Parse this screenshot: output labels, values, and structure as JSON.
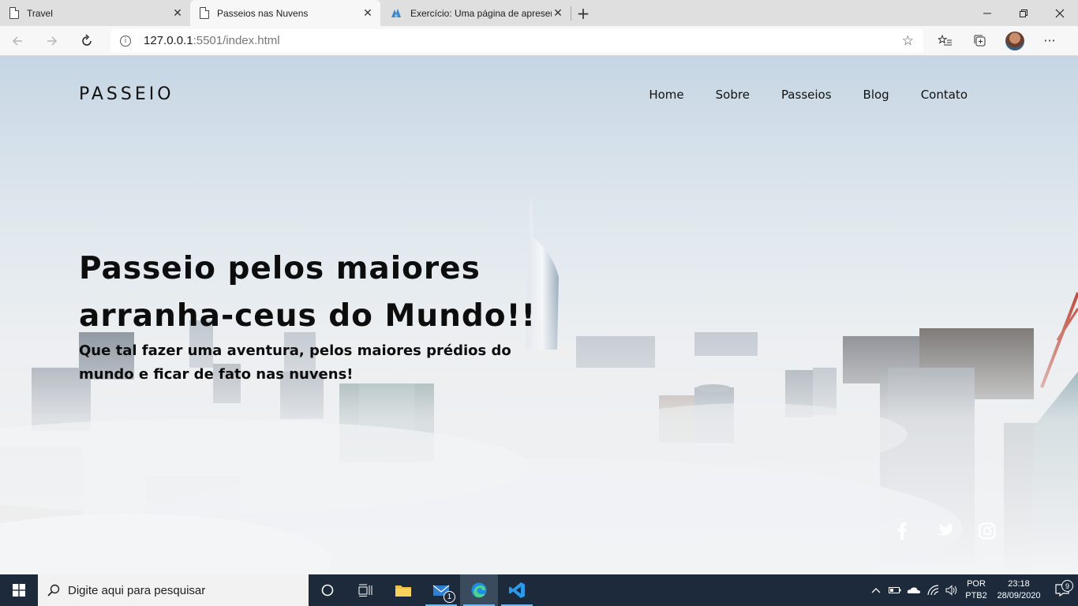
{
  "browser": {
    "tabs": [
      {
        "title": "Travel",
        "active": false,
        "icon": "page-icon"
      },
      {
        "title": "Passeios nas Nuvens",
        "active": true,
        "icon": "page-icon"
      },
      {
        "title": "Exercício: Uma página de apresen",
        "active": false,
        "icon": "edu-icon"
      }
    ],
    "new_tab": "+",
    "url_host": "127.0.0.1",
    "url_rest": ":5501/index.html"
  },
  "site": {
    "logo": "PASSEIO",
    "menu": [
      "Home",
      "Sobre",
      "Passeios",
      "Blog",
      "Contato"
    ],
    "hero_title": "Passeio pelos maiores arranha-ceus do Mundo!!",
    "hero_subtitle": "Que tal fazer uma aventura, pelos maiores prédios do mundo e ficar de fato nas nuvens!",
    "socials": [
      "facebook-icon",
      "twitter-icon",
      "instagram-icon"
    ]
  },
  "taskbar": {
    "search_placeholder": "Digite aqui para pesquisar",
    "mail_badge": "1",
    "lang_top": "POR",
    "lang_bottom": "PTB2",
    "time": "23:18",
    "date": "28/09/2020",
    "notif_count": "9"
  }
}
